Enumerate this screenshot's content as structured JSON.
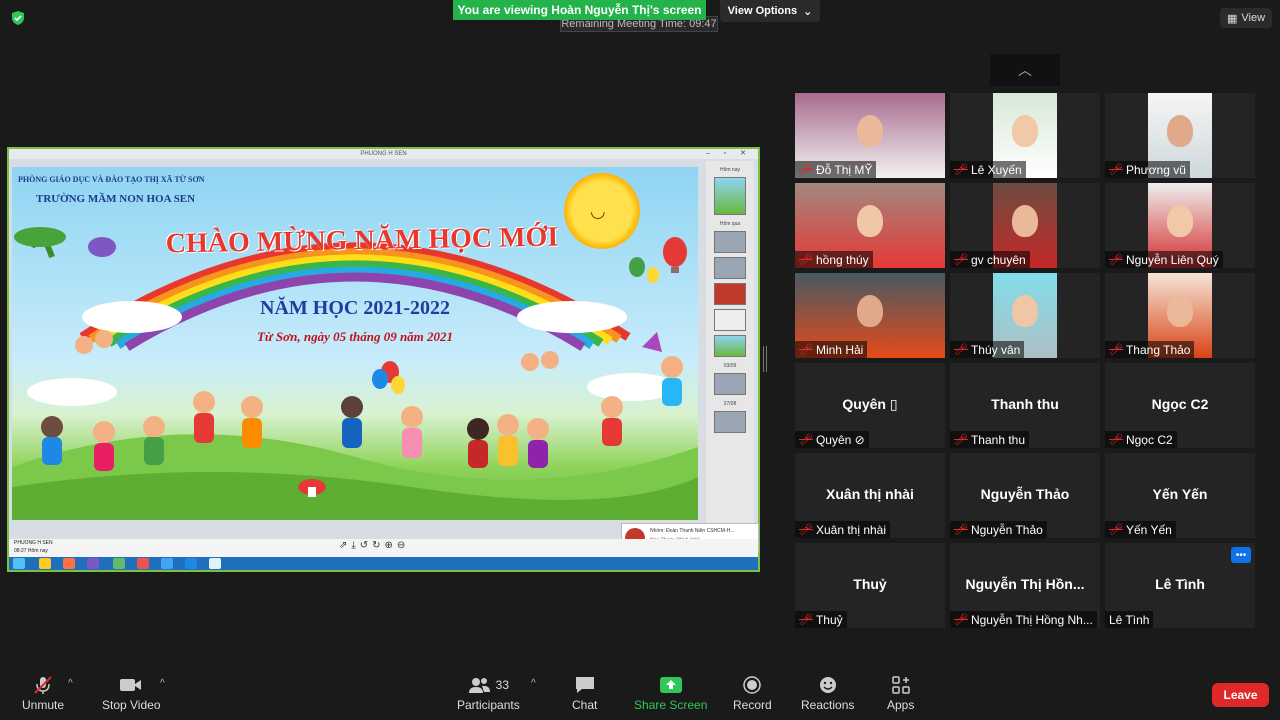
{
  "top": {
    "viewing_banner": "You are viewing Hoàn Nguyễn Thị's screen",
    "remaining": "Remaining Meeting Time: 09:47",
    "view_options": "View Options",
    "view_button": "View"
  },
  "shared_screen": {
    "window_title": "PHUONG H SEN",
    "slide": {
      "org_line1": "PHÒNG GIÁO DỤC VÀ ĐÀO TẠO THỊ XÃ TỪ SƠN",
      "org_line2": "TRƯỜNG MẦM NON HOA SEN",
      "headline": "CHÀO MỪNG NĂM HỌC MỚI",
      "school_year": "NĂM HỌC 2021-2022",
      "dateline": "Từ Sơn, ngày 05 tháng 09 năm 2021"
    },
    "rail": {
      "today": "Hôm nay",
      "yesterday": "Hôm qua",
      "date1": "03/09",
      "date2": "27/08"
    },
    "viewer_user": "PHUONG H SEN",
    "viewer_time": "08:27 Hôm nay",
    "notification_title": "Nhóm: Đoàn Thanh Niên CSHCM-H...",
    "notification_body": "Hoa Pham: [Hình ảnh]"
  },
  "participants": [
    {
      "name": "Đỗ Thị MỸ",
      "video": true
    },
    {
      "name": "Lê Xuyến",
      "video": true
    },
    {
      "name": "Phương vũ",
      "video": true
    },
    {
      "name": "hồng thúy",
      "video": true
    },
    {
      "name": "gv chuyên",
      "video": true
    },
    {
      "name": "Nguyễn Liên Quý",
      "video": true
    },
    {
      "name": "Minh Hải",
      "video": true
    },
    {
      "name": "Thúy vân",
      "video": true
    },
    {
      "name": "Thang Thảo",
      "video": true
    },
    {
      "name": "Quyên ⊘",
      "center": "Quyên ▯",
      "video": false
    },
    {
      "name": "Thanh thu",
      "center": "Thanh thu",
      "video": false
    },
    {
      "name": "Ngọc C2",
      "center": "Ngọc C2",
      "video": false
    },
    {
      "name": "Xuân thị nhài",
      "center": "Xuân thị nhài",
      "video": false
    },
    {
      "name": "Nguyễn Thảo",
      "center": "Nguyễn Thảo",
      "video": false
    },
    {
      "name": "Yến Yến",
      "center": "Yến Yến",
      "video": false
    },
    {
      "name": "Thuỷ",
      "center": "Thuỷ",
      "video": false
    },
    {
      "name": "Nguyễn Thị Hồng Nh...",
      "center": "Nguyễn Thị Hồn...",
      "video": false
    },
    {
      "name": "Lê Tình",
      "center": "Lê Tình",
      "video": false,
      "muted": false
    }
  ],
  "toolbar": {
    "unmute": "Unmute",
    "stop_video": "Stop Video",
    "participants": "Participants",
    "participants_count": "33",
    "chat": "Chat",
    "share_screen": "Share Screen",
    "record": "Record",
    "reactions": "Reactions",
    "apps": "Apps",
    "leave": "Leave"
  },
  "colors": {
    "share_green": "#2fc75a",
    "leave_red": "#e02828",
    "muted_red": "#e02828",
    "banner_green": "#24b24b"
  }
}
